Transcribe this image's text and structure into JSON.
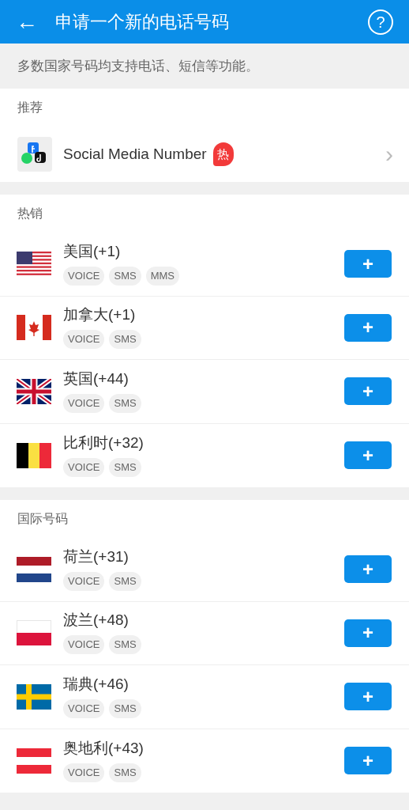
{
  "header": {
    "back": "←",
    "title": "申请一个新的电话号码",
    "help": "?"
  },
  "notice": "多数国家号码均支持电话、短信等功能。",
  "sections": [
    {
      "title": "推荐",
      "kind": "promo",
      "items": [
        {
          "name": "Social Media Number",
          "badge": "热",
          "chevron": "›"
        }
      ]
    },
    {
      "title": "热销",
      "kind": "countries",
      "items": [
        {
          "name": "美国(+1)",
          "kind": "us",
          "tags": [
            "VOICE",
            "SMS",
            "MMS"
          ],
          "button": "+"
        },
        {
          "name": "加拿大(+1)",
          "kind": "ca",
          "tags": [
            "VOICE",
            "SMS"
          ],
          "button": "+"
        },
        {
          "name": "英国(+44)",
          "kind": "gb",
          "tags": [
            "VOICE",
            "SMS"
          ],
          "button": "+"
        },
        {
          "name": "比利时(+32)",
          "kind": "be",
          "tags": [
            "VOICE",
            "SMS"
          ],
          "button": "+"
        }
      ]
    },
    {
      "title": "国际号码",
      "kind": "countries",
      "items": [
        {
          "name": "荷兰(+31)",
          "kind": "nl",
          "tags": [
            "VOICE",
            "SMS"
          ],
          "button": "+"
        },
        {
          "name": "波兰(+48)",
          "kind": "pl",
          "tags": [
            "VOICE",
            "SMS"
          ],
          "button": "+"
        },
        {
          "name": "瑞典(+46)",
          "kind": "se",
          "tags": [
            "VOICE",
            "SMS"
          ],
          "button": "+"
        },
        {
          "name": "奥地利(+43)",
          "kind": "at",
          "tags": [
            "VOICE",
            "SMS"
          ],
          "button": "+"
        }
      ]
    }
  ]
}
